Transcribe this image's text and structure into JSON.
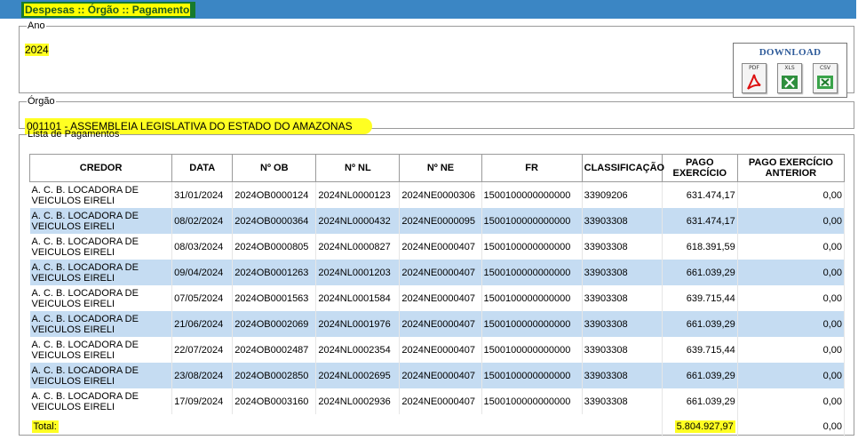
{
  "header": {
    "title": "Despesas :: Órgão :: Pagamento"
  },
  "ano": {
    "legend": "Ano",
    "value": "2024"
  },
  "download": {
    "title": "DOWNLOAD",
    "formats": [
      {
        "label": "PDF",
        "icon": "pdf-icon"
      },
      {
        "label": "XLS",
        "icon": "xls-icon"
      },
      {
        "label": "CSV",
        "icon": "csv-icon"
      }
    ]
  },
  "orgao": {
    "legend": "Órgão",
    "value": "001101 - ASSEMBLEIA LEGISLATIVA DO ESTADO DO AMAZONAS"
  },
  "lista": {
    "legend": "Lista de Pagamentos",
    "columns": [
      "CREDOR",
      "DATA",
      "Nº OB",
      "Nº NL",
      "Nº NE",
      "FR",
      "CLASSIFICAÇÃO",
      "PAGO EXERCÍCIO",
      "PAGO EXERCÍCIO ANTERIOR"
    ],
    "rows": [
      [
        "A. C. B. LOCADORA DE VEICULOS EIRELI",
        "31/01/2024",
        "2024OB0000124",
        "2024NL0000123",
        "2024NE0000306",
        "1500100000000000",
        "33909206",
        "631.474,17",
        "0,00"
      ],
      [
        "A. C. B. LOCADORA DE VEICULOS EIRELI",
        "08/02/2024",
        "2024OB0000364",
        "2024NL0000432",
        "2024NE0000095",
        "1500100000000000",
        "33903308",
        "631.474,17",
        "0,00"
      ],
      [
        "A. C. B. LOCADORA DE VEICULOS EIRELI",
        "08/03/2024",
        "2024OB0000805",
        "2024NL0000827",
        "2024NE0000407",
        "1500100000000000",
        "33903308",
        "618.391,59",
        "0,00"
      ],
      [
        "A. C. B. LOCADORA DE VEICULOS EIRELI",
        "09/04/2024",
        "2024OB0001263",
        "2024NL0001203",
        "2024NE0000407",
        "1500100000000000",
        "33903308",
        "661.039,29",
        "0,00"
      ],
      [
        "A. C. B. LOCADORA DE VEICULOS EIRELI",
        "07/05/2024",
        "2024OB0001563",
        "2024NL0001584",
        "2024NE0000407",
        "1500100000000000",
        "33903308",
        "639.715,44",
        "0,00"
      ],
      [
        "A. C. B. LOCADORA DE VEICULOS EIRELI",
        "21/06/2024",
        "2024OB0002069",
        "2024NL0001976",
        "2024NE0000407",
        "1500100000000000",
        "33903308",
        "661.039,29",
        "0,00"
      ],
      [
        "A. C. B. LOCADORA DE VEICULOS EIRELI",
        "22/07/2024",
        "2024OB0002487",
        "2024NL0002354",
        "2024NE0000407",
        "1500100000000000",
        "33903308",
        "639.715,44",
        "0,00"
      ],
      [
        "A. C. B. LOCADORA DE VEICULOS EIRELI",
        "23/08/2024",
        "2024OB0002850",
        "2024NL0002695",
        "2024NE0000407",
        "1500100000000000",
        "33903308",
        "661.039,29",
        "0,00"
      ],
      [
        "A. C. B. LOCADORA DE VEICULOS EIRELI",
        "17/09/2024",
        "2024OB0003160",
        "2024NL0002936",
        "2024NE0000407",
        "1500100000000000",
        "33903308",
        "661.039,29",
        "0,00"
      ]
    ],
    "total": {
      "label": "Total:",
      "pago_exercicio": "5.804.927,97",
      "pago_exercicio_anterior": "0,00"
    }
  }
}
